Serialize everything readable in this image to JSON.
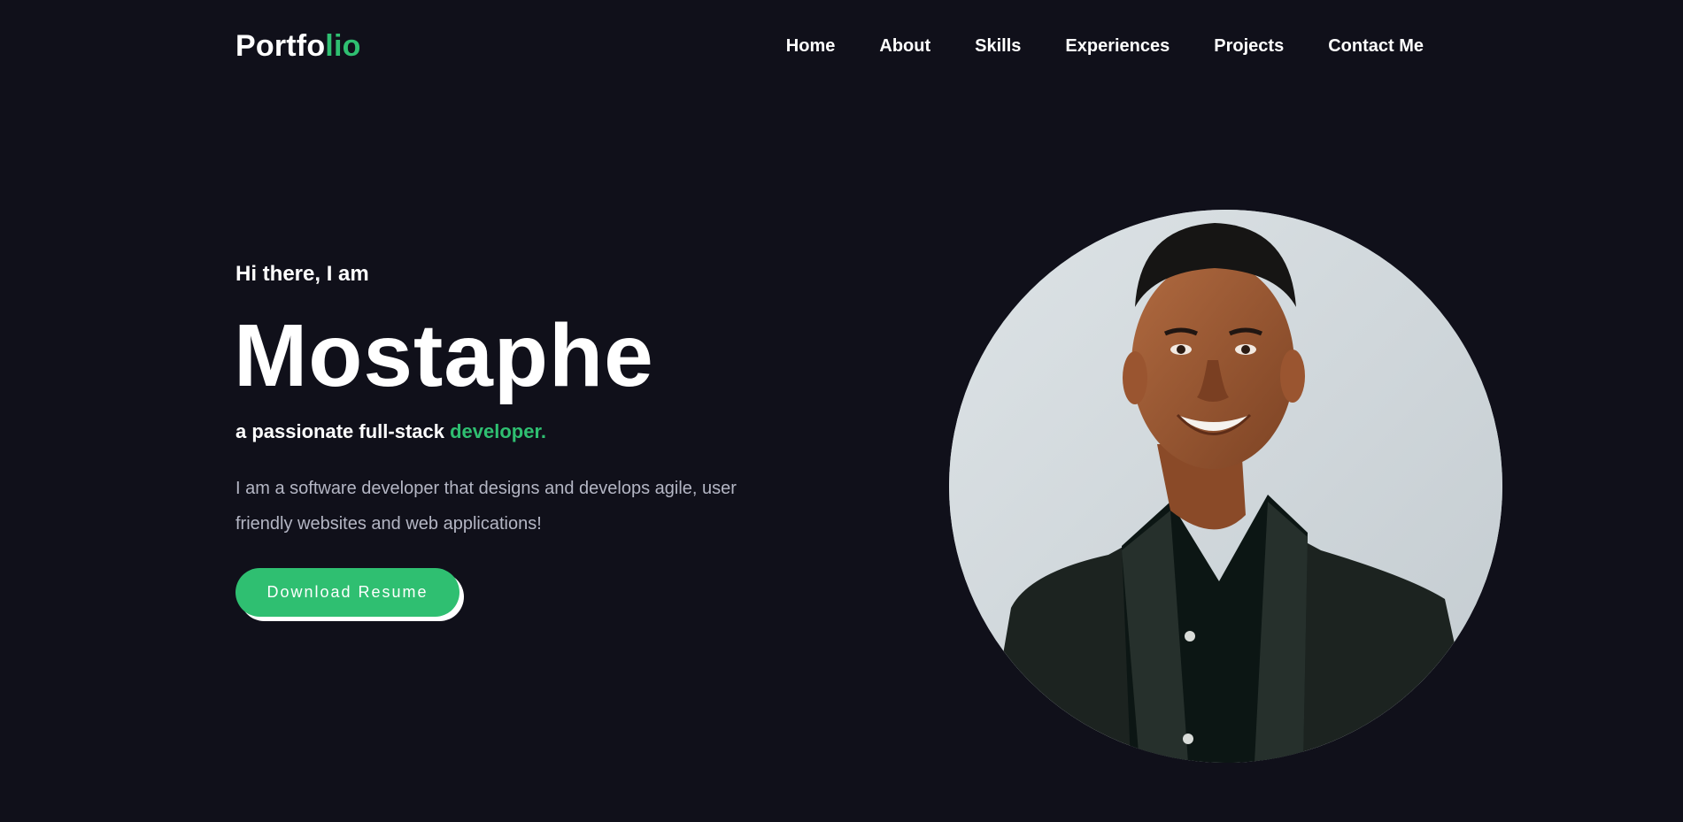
{
  "header": {
    "logo_main": "Portfo",
    "logo_accent": "lio",
    "nav": [
      "Home",
      "About",
      "Skills",
      "Experiences",
      "Projects",
      "Contact Me"
    ]
  },
  "hero": {
    "greeting": "Hi there, I am",
    "name": "Mostaphe",
    "tagline_main": "a passionate full-stack",
    "tagline_accent": "developer.",
    "bio": "I am a software developer that designs and develops agile, user friendly websites and web applications!",
    "button_label": "Download Resume"
  },
  "colors": {
    "background": "#10101a",
    "accent": "#2fbf71",
    "text": "#ffffff",
    "muted": "#b4b6c4"
  }
}
